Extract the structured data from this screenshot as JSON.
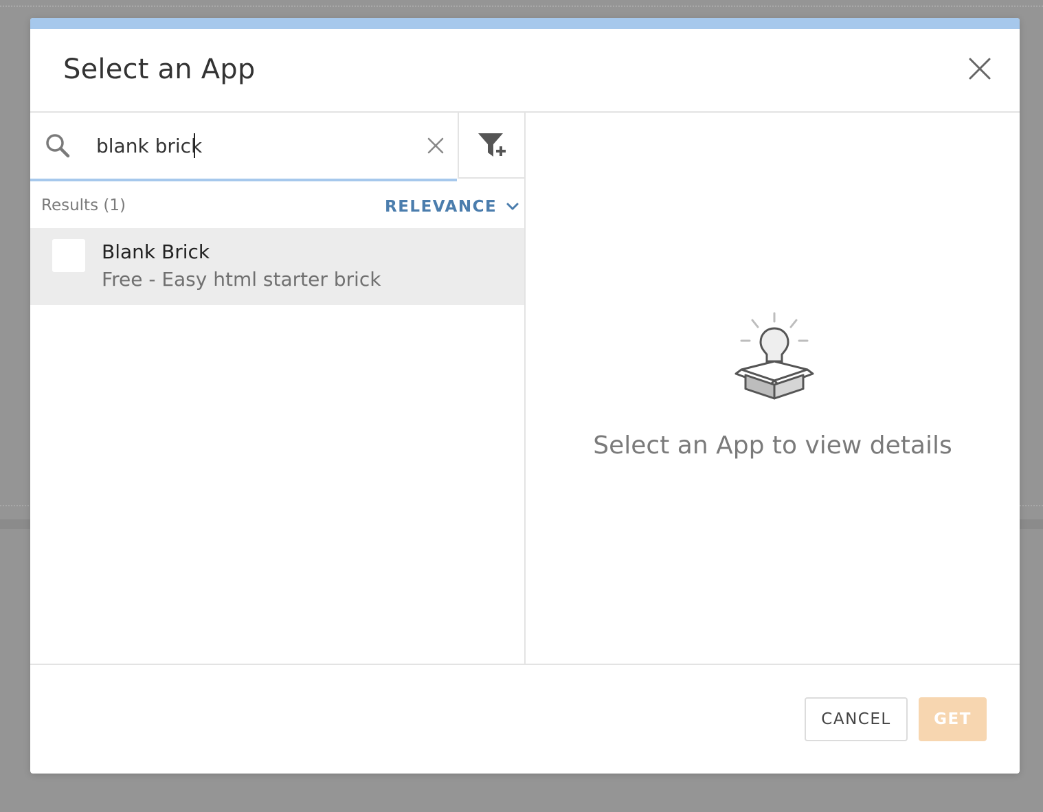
{
  "modal": {
    "title": "Select an App",
    "accent_color": "#a6c8ec"
  },
  "search": {
    "value": "blank brick",
    "placeholder": ""
  },
  "results": {
    "count_label": "Results (1)",
    "sort_label": "RELEVANCE",
    "items": [
      {
        "name": "Blank Brick",
        "description": "Free - Easy html starter brick"
      }
    ]
  },
  "details": {
    "empty_message": "Select an App to view details"
  },
  "footer": {
    "cancel_label": "CANCEL",
    "get_label": "GET"
  },
  "icons": {
    "close": "close-icon",
    "search": "search-icon",
    "clear": "clear-icon",
    "filter": "filter-add-icon",
    "sort": "chevron-down-icon",
    "empty_state": "lightbulb-box-icon"
  },
  "colors": {
    "sort_link": "#4b7dad",
    "get_button_disabled": "#f7d6b0",
    "selected_row": "#ececec"
  }
}
